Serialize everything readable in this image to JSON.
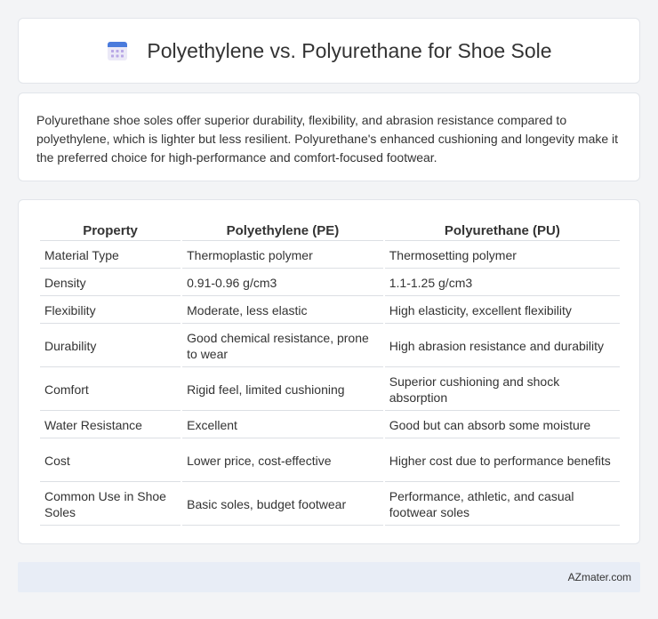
{
  "header": {
    "title": "Polyethylene vs. Polyurethane for Shoe Sole",
    "icon": "calendar-grid-icon",
    "icon_colors": {
      "top": "#4a7bdc",
      "body": "#e8e6f5",
      "dots": "#b9a8e6"
    }
  },
  "summary": {
    "text": "Polyurethane shoe soles offer superior durability, flexibility, and abrasion resistance compared to polyethylene, which is lighter but less resilient. Polyurethane's enhanced cushioning and longevity make it the preferred choice for high-performance and comfort-focused footwear."
  },
  "table": {
    "headers": [
      "Property",
      "Polyethylene (PE)",
      "Polyurethane (PU)"
    ],
    "rows": [
      [
        "Material Type",
        "Thermoplastic polymer",
        "Thermosetting polymer"
      ],
      [
        "Density",
        "0.91-0.96 g/cm3",
        "1.1-1.25 g/cm3"
      ],
      [
        "Flexibility",
        "Moderate, less elastic",
        "High elasticity, excellent flexibility"
      ],
      [
        "Durability",
        "Good chemical resistance, prone to wear",
        "High abrasion resistance and durability"
      ],
      [
        "Comfort",
        "Rigid feel, limited cushioning",
        "Superior cushioning and shock absorption"
      ],
      [
        "Water Resistance",
        "Excellent",
        "Good but can absorb some moisture"
      ],
      [
        "Cost",
        "Lower price, cost-effective",
        "Higher cost due to performance benefits"
      ],
      [
        "Common Use in Shoe Soles",
        "Basic soles, budget footwear",
        "Performance, athletic, and casual footwear soles"
      ]
    ]
  },
  "footer": {
    "text": "AZmater.com"
  }
}
